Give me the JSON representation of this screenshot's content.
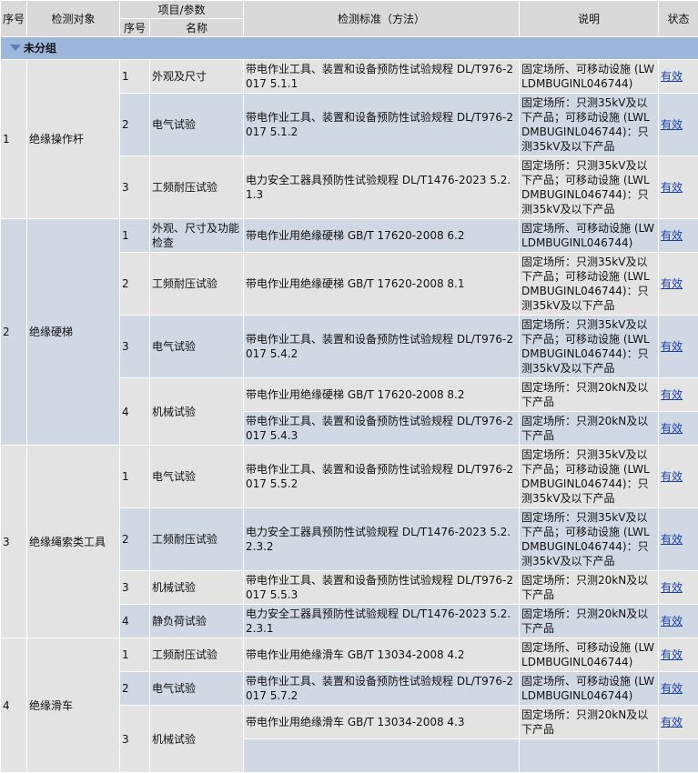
{
  "headers": {
    "seq": "序号",
    "object": "检测对象",
    "param_group": "项目/参数",
    "param_seq": "序号",
    "param_name": "名称",
    "standard": "检测标准（方法）",
    "note": "说明",
    "status": "状态"
  },
  "group_label": "未分组",
  "status_label": "有效",
  "rows": [
    {
      "cat_seq": "1",
      "cat_name": "绝缘操作杆",
      "p_seq": "1",
      "p_name": "外观及尺寸",
      "std": "带电作业工具、装置和设备预防性试验规程 DL/T976-2017 5.1.1",
      "note": "固定场所、可移动设施 (LWLDMBUGINL046744)"
    },
    {
      "p_seq": "2",
      "p_name": "电气试验",
      "std": "带电作业工具、装置和设备预防性试验规程 DL/T976-2017 5.1.2",
      "note": "固定场所：只测35kV及以下产品；可移动设施 (LWLDMBUGINL046744)：只测35kV及以下产品"
    },
    {
      "p_seq": "3",
      "p_name": "工频耐压试验",
      "std": "电力安全工器具预防性试验规程 DL/T1476-2023 5.2.1.3",
      "note": "固定场所：只测35kV及以下产品；可移动设施 (LWLDMBUGINL046744)：只测35kV及以下产品"
    },
    {
      "cat_seq": "2",
      "cat_name": "绝缘硬梯",
      "p_seq": "1",
      "p_name": "外观、尺寸及功能检查",
      "std": "带电作业用绝缘硬梯 GB/T 17620-2008 6.2",
      "note": "固定场所、可移动设施 (LWLDMBUGINL046744)"
    },
    {
      "p_seq": "2",
      "p_name": "工频耐压试验",
      "std": "带电作业用绝缘硬梯 GB/T 17620-2008 8.1",
      "note": "固定场所：只测35kV及以下产品；可移动设施 (LWLDMBUGINL046744)：只测35kV及以下产品"
    },
    {
      "p_seq": "3",
      "p_name": "电气试验",
      "std": "带电作业工具、装置和设备预防性试验规程 DL/T976-2017 5.4.2",
      "note": "固定场所：只测35kV及以下产品；可移动设施 (LWLDMBUGINL046744)：只测35kV及以下产品"
    },
    {
      "p_seq": "4",
      "p_name": "机械试验",
      "std": "带电作业用绝缘硬梯 GB/T 17620-2008 8.2",
      "note": "固定场所：只测20kN及以下产品"
    },
    {
      "std": "带电作业工具、装置和设备预防性试验规程 DL/T976-2017 5.4.3",
      "note": "固定场所：只测20kN及以下产品"
    },
    {
      "cat_seq": "3",
      "cat_name": "绝缘绳索类工具",
      "p_seq": "1",
      "p_name": "电气试验",
      "std": "带电作业工具、装置和设备预防性试验规程 DL/T976-2017 5.5.2",
      "note": "固定场所：只测35kV及以下产品；可移动设施 (LWLDMBUGINL046744)：只测35kV及以下产品"
    },
    {
      "p_seq": "2",
      "p_name": "工频耐压试验",
      "std": "电力安全工器具预防性试验规程 DL/T1476-2023 5.2.2.3.2",
      "note": "固定场所：只测35kV及以下产品；可移动设施 (LWLDMBUGINL046744)：只测35kV及以下产品"
    },
    {
      "p_seq": "3",
      "p_name": "机械试验",
      "std": "带电作业工具、装置和设备预防性试验规程 DL/T976-2017 5.5.3",
      "note": "固定场所：只测20kN及以下产品"
    },
    {
      "p_seq": "4",
      "p_name": "静负荷试验",
      "std": "电力安全工器具预防性试验规程 DL/T1476-2023 5.2.2.3.1",
      "note": "固定场所：只测20kN及以下产品"
    },
    {
      "cat_seq": "4",
      "cat_name": "绝缘滑车",
      "p_seq": "1",
      "p_name": "工频耐压试验",
      "std": "带电作业用绝缘滑车 GB/T 13034-2008 4.2",
      "note": "固定场所、可移动设施 (LWLDMBUGINL046744)"
    },
    {
      "p_seq": "2",
      "p_name": "电气试验",
      "std": "带电作业工具、装置和设备预防性试验规程 DL/T976-2017 5.7.2",
      "note": "固定场所、可移动设施 (LWLDMBUGINL046744)"
    },
    {
      "p_seq": "3",
      "p_name": "机械试验",
      "std": "带电作业用绝缘滑车 GB/T 13034-2008 4.3",
      "note": "固定场所：只测20kN及以下产品"
    },
    {
      "std": "",
      "note": ""
    }
  ]
}
